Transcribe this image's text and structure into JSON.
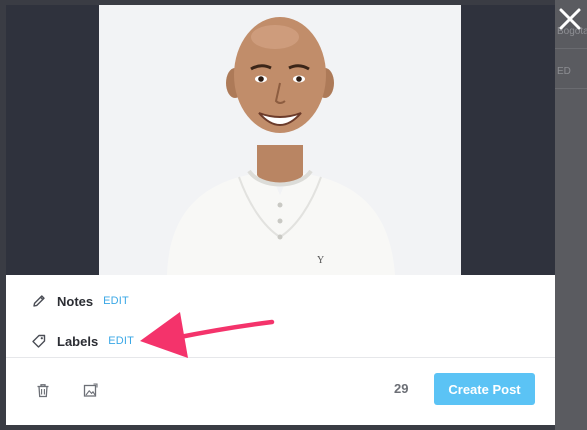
{
  "background_app": {
    "fragment_1": "Bogota",
    "fragment_2": "ED"
  },
  "modal": {
    "photo_alt": "Portrait photo of a smiling bald man in a white henley shirt",
    "notes": {
      "label": "Notes",
      "edit_label": "EDIT"
    },
    "labels": {
      "label": "Labels",
      "edit_label": "EDIT"
    },
    "footer": {
      "count": "29",
      "create_post_label": "Create Post",
      "delete_icon": "trash-icon",
      "image_icon": "image-edit-icon"
    }
  },
  "icons": {
    "notes": "pencil-icon",
    "labels": "tag-icon",
    "close": "close-icon"
  },
  "annotation": {
    "color": "#f4336b",
    "target": "labels-edit-link"
  },
  "colors": {
    "accent": "#3aa7e6",
    "button": "#5bc3f5",
    "photo_backdrop": "#2f323d"
  }
}
